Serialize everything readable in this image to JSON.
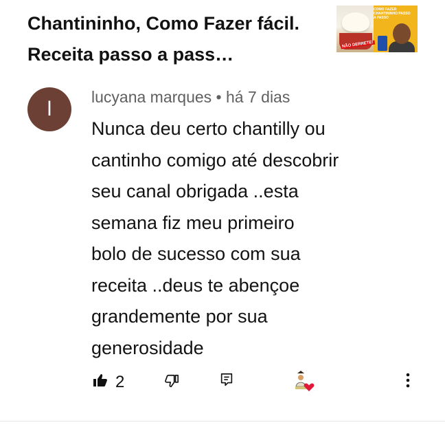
{
  "video": {
    "title": "Chantininho, Como Fazer fácil. Receita passo a pass…",
    "thumbnail": {
      "header_text": "COMO FAZER CHANTININHO PASSO A PASSO",
      "badge_text": "NÃO DERRETE!"
    }
  },
  "comment": {
    "avatar_letter": "l",
    "author": "lucyana marques",
    "separator": "•",
    "time": "há 7 dias",
    "lines": [
      "Nunca deu certo chantilly ou",
      "cantinho comigo até descobrir",
      "seu canal obrigada ..esta",
      "semana fiz meu primeiro",
      "bolo de sucesso com sua",
      "receita ..deus te abençoe",
      "grandemente por sua",
      "generosidade"
    ],
    "like_count": "2"
  },
  "icons": {
    "like": "thumb-up-filled-icon",
    "dislike": "thumb-down-icon",
    "reply": "reply-comment-icon",
    "creator_heart": "creator-heart-icon",
    "more": "more-vertical-icon"
  },
  "colors": {
    "avatar_bg": "#6d4035",
    "meta_text": "#606060",
    "heart": "#e0183a"
  }
}
